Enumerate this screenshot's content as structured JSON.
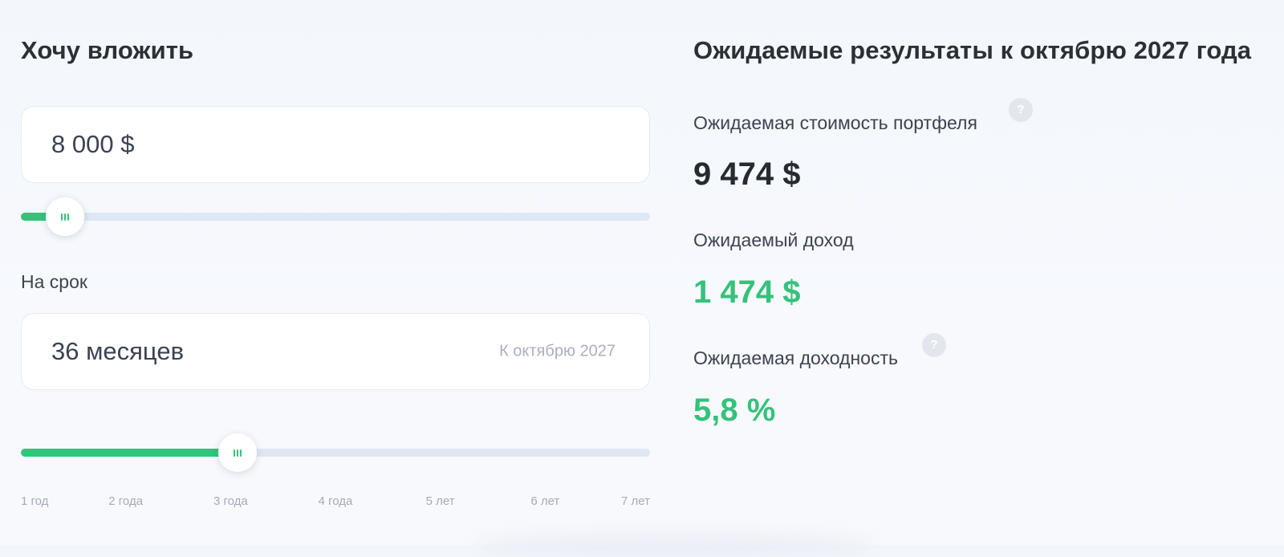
{
  "invest": {
    "title": "Хочу вложить",
    "amount_value": "8 000 $",
    "amount_slider_fraction": 0.07
  },
  "term": {
    "label": "На срок",
    "value": "36 месяцев",
    "hint": "К октябрю 2027",
    "slider_fraction": 0.345,
    "ticks": [
      "1 год",
      "2 года",
      "3 года",
      "4 года",
      "5 лет",
      "6 лет",
      "7 лет"
    ]
  },
  "results": {
    "title": "Ожидаемые результаты к октябрю 2027 года",
    "portfolio_label": "Ожидаемая стоимость портфеля",
    "portfolio_value": "9 474 $",
    "income_label": "Ожидаемый доход",
    "income_value": "1 474 $",
    "yield_label": "Ожидаемая доходность",
    "yield_value": "5,8 %",
    "help_glyph": "?"
  },
  "icons": {
    "slider_thumb": "grip-icon",
    "help": "question-icon"
  },
  "colors": {
    "accent": "#33c47a",
    "track": "#dfe7f2",
    "value_green": "#35c27b"
  }
}
